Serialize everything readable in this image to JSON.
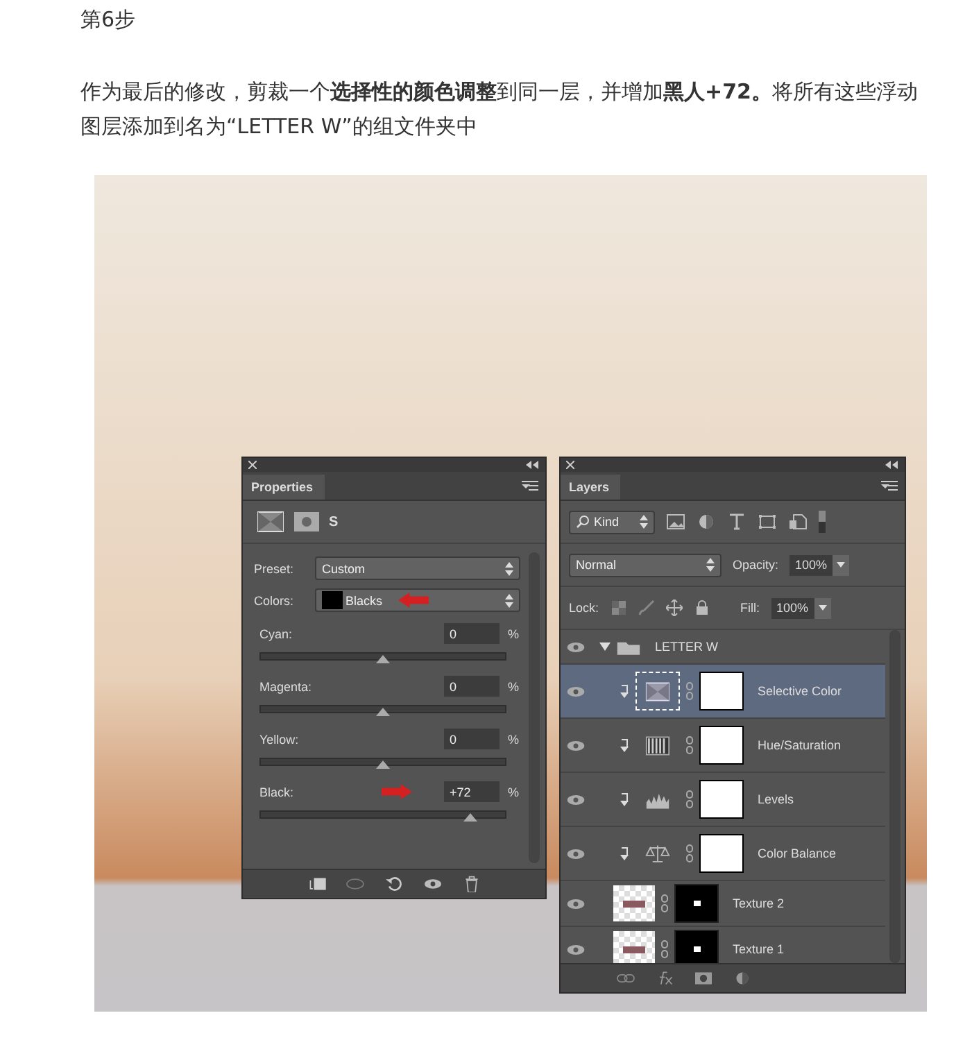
{
  "heading": "第6步",
  "paragraph": "作为最后的修改，剪裁一个**选择性的颜色调整**到同一层，并增加**黑人+72。**将所有这些浮动图层添加到名为“LETTER W”的组文件夹中",
  "properties": {
    "title": "Properties",
    "layer_name": "S",
    "preset_label": "Preset:",
    "preset": "Custom",
    "colors_label": "Colors:",
    "colors": "Blacks",
    "sliders": [
      {
        "label": "Cyan:",
        "value": "0",
        "unit": "%",
        "level": 0.5
      },
      {
        "label": "Magenta:",
        "value": "0",
        "unit": "%",
        "level": 0.5
      },
      {
        "label": "Yellow:",
        "value": "0",
        "unit": "%",
        "level": 0.5
      },
      {
        "label": "Black:",
        "value": "+72",
        "unit": "%",
        "level": 0.86
      }
    ]
  },
  "layers": {
    "title": "Layers",
    "filter": "Kind",
    "blend_mode": "Normal",
    "opacity_label": "Opacity:",
    "opacity": "100%",
    "lock_label": "Lock:",
    "fill_label": "Fill:",
    "fill": "100%",
    "items": [
      {
        "name": "LETTER W",
        "kind": "group",
        "expanded": true,
        "selected": false,
        "children": [
          {
            "name": "Selective Color",
            "kind": "selective",
            "selected": true
          },
          {
            "name": "Hue/Saturation",
            "kind": "hue",
            "selected": false
          },
          {
            "name": "Levels",
            "kind": "levels",
            "selected": false
          },
          {
            "name": "Color Balance",
            "kind": "balance",
            "selected": false
          }
        ]
      },
      {
        "name": "Texture 2",
        "kind": "texture",
        "selected": false
      },
      {
        "name": "Texture 1",
        "kind": "texture",
        "selected": false
      }
    ]
  }
}
